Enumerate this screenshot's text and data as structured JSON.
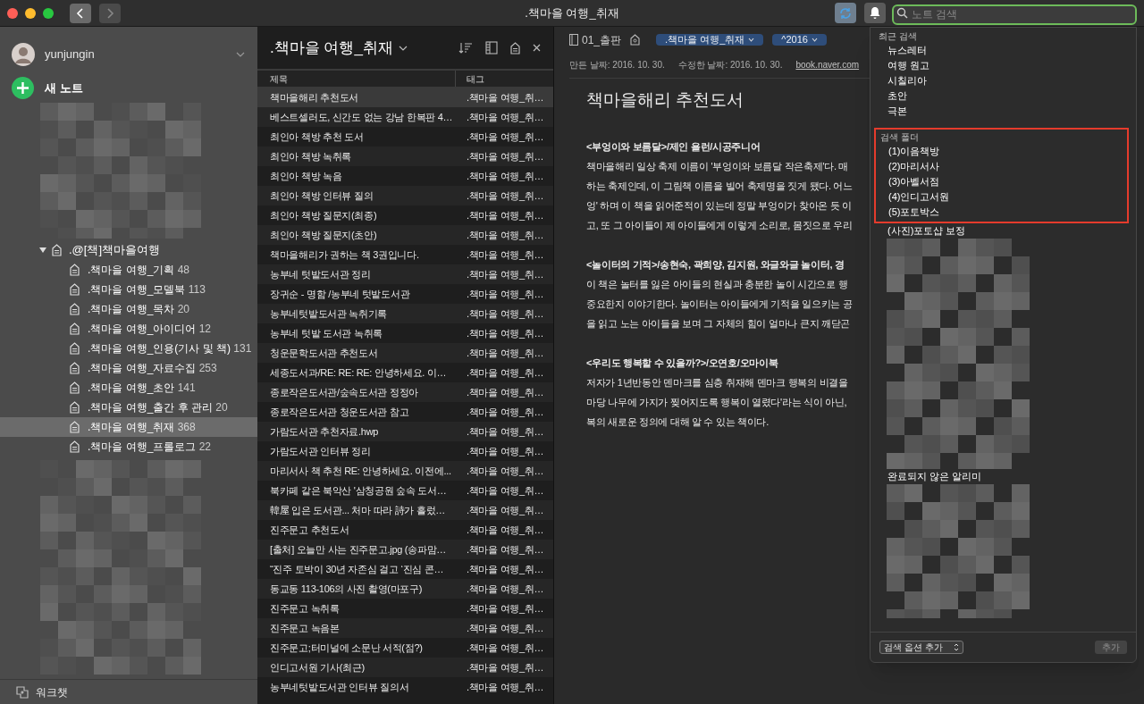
{
  "window": {
    "title": ".책마을 여행_취재"
  },
  "toolbar": {
    "back_enabled": true,
    "forward_enabled": false,
    "search": {
      "placeholder": "노트 검색"
    }
  },
  "sidebar": {
    "account": "yunjungin",
    "new_note": "새 노트",
    "notebooks": [
      {
        "name": ".@[책]책마을여행",
        "expanded": true,
        "children": [
          {
            "name": ".책마을 여행_기획",
            "count": "48",
            "selected": false
          },
          {
            "name": ".책마을 여행_모델북",
            "count": "113",
            "selected": false
          },
          {
            "name": ".책마을 여행_목차",
            "count": "20",
            "selected": false
          },
          {
            "name": ".책마을 여행_아이디어",
            "count": "12",
            "selected": false
          },
          {
            "name": ".책마을 여행_인용(기사 및 책)",
            "count": "131",
            "selected": false
          },
          {
            "name": ".책마을 여행_자료수집",
            "count": "253",
            "selected": false
          },
          {
            "name": ".책마을 여행_초안",
            "count": "141",
            "selected": false
          },
          {
            "name": ".책마을 여행_출간 후 관리",
            "count": "20",
            "selected": false
          },
          {
            "name": ".책마을 여행_취재",
            "count": "368",
            "selected": true
          },
          {
            "name": ".책마을 여행_프롤로그",
            "count": "22",
            "selected": false
          }
        ]
      }
    ],
    "footer": "워크챗"
  },
  "note_list": {
    "title": ".책마을 여행_취재",
    "columns": [
      "제목",
      "태그"
    ],
    "rows": [
      {
        "title": "책마을해리 추천도서",
        "tag": ".책마을 여행_취…",
        "selected": true
      },
      {
        "title": "베스트셀러도, 신간도 없는 강남 한복판 4…",
        "tag": ".책마을 여행_취…",
        "selected": false
      },
      {
        "title": "최인아 책방 추천 도서",
        "tag": ".책마을 여행_취…",
        "selected": false
      },
      {
        "title": "최인아 책방 녹취록",
        "tag": ".책마을 여행_취…",
        "selected": false
      },
      {
        "title": "최인아 책방 녹음",
        "tag": ".책마을 여행_취…",
        "selected": false
      },
      {
        "title": "최인아 책방 인터뷰 질의",
        "tag": ".책마을 여행_취…",
        "selected": false
      },
      {
        "title": "최인아 책방 질문지(최종)",
        "tag": ".책마을 여행_취…",
        "selected": false
      },
      {
        "title": "최인아 책방 질문지(초안)",
        "tag": ".책마을 여행_취…",
        "selected": false
      },
      {
        "title": "책마을해리가 권하는 책 3권입니다.",
        "tag": ".책마을 여행_취…",
        "selected": false
      },
      {
        "title": "농부네 텃밭도서관 정리",
        "tag": ".책마을 여행_취…",
        "selected": false
      },
      {
        "title": "장귀순 - 명함 /농부네 텃밭도서관",
        "tag": ".책마을 여행_취…",
        "selected": false
      },
      {
        "title": "농부네텃밭도서관 녹취기록",
        "tag": ".책마을 여행_취…",
        "selected": false
      },
      {
        "title": "농부네 텃밭 도서관 녹취록",
        "tag": ".책마을 여행_취…",
        "selected": false
      },
      {
        "title": "청운문학도서관 추천도서",
        "tag": ".책마을 여행_취…",
        "selected": false
      },
      {
        "title": "세종도서과/RE: RE: RE: 안녕하세요. 이…",
        "tag": ".책마을 여행_취…",
        "selected": false
      },
      {
        "title": "종로작은도서관/숲속도서관 정정아",
        "tag": ".책마을 여행_취…",
        "selected": false
      },
      {
        "title": "종로작은도서관 청운도서관 참고",
        "tag": ".책마을 여행_취…",
        "selected": false
      },
      {
        "title": "가람도서관 추천자료.hwp",
        "tag": ".책마을 여행_취…",
        "selected": false
      },
      {
        "title": "가람도서관 인터뷰 정리",
        "tag": ".책마을 여행_취…",
        "selected": false
      },
      {
        "title": "마리서사 책 추천 RE: 안녕하세요. 이전에...",
        "tag": ".책마을 여행_취…",
        "selected": false
      },
      {
        "title": "북카페 같은 북악산 '삼청공원 숲속 도서…",
        "tag": ".책마을 여행_취…",
        "selected": false
      },
      {
        "title": "韓屋 입은 도서관... 처마 따라 詩가 흘렀…",
        "tag": ".책마을 여행_취…",
        "selected": false
      },
      {
        "title": "진주문고 추천도서",
        "tag": ".책마을 여행_취…",
        "selected": false
      },
      {
        "title": "[출처] 오늘만 사는 진주문고.jpg (송파맘…",
        "tag": ".책마을 여행_취…",
        "selected": false
      },
      {
        "title": "“진주 토박이 30년 자존심 걸고 ‘진심 콘…",
        "tag": ".책마을 여행_취…",
        "selected": false
      },
      {
        "title": "동교동 113-106의 사진 촬영(마포구)",
        "tag": ".책마을 여행_취…",
        "selected": false
      },
      {
        "title": "진주문고 녹취록",
        "tag": ".책마을 여행_취…",
        "selected": false
      },
      {
        "title": "진주문고 녹음본",
        "tag": ".책마을 여행_취…",
        "selected": false
      },
      {
        "title": "진주문고;터미널에 소문난 서적(점?)",
        "tag": ".책마을 여행_취…",
        "selected": false
      },
      {
        "title": "인디고서원 기사(최근)",
        "tag": ".책마을 여행_취…",
        "selected": false
      },
      {
        "title": "농부네텃밭도서관 인터뷰 질의서",
        "tag": ".책마을 여행_취…",
        "selected": false
      }
    ]
  },
  "editor": {
    "notebook": "01_출판",
    "tags": [
      ".책마을 여행_취재",
      "^2016"
    ],
    "created": "만든 날짜: 2016. 10. 30.",
    "modified": "수정한 날짜: 2016. 10. 30.",
    "source_url": "book.naver.com",
    "title": "책마을해리 추천도서",
    "paragraphs": [
      {
        "heading": "<부엉이와 보름달>/제인 욜런/시공주니어",
        "lines": [
          "책마을해리 일상 축제 이름이 '부엉이와 보름달 작은축제'다. 매",
          "하는 축제인데, 이 그림책 이름을 빌어 축제명을 짓게 됐다. 어느",
          "엉' 하며 이 책을 읽어준적이 있는데 정말 부엉이가 찾아온 듯 이",
          "고, 또 그 아이들이 제 아이들에게 이렇게 소리로, 몸짓으로 우리"
        ]
      },
      {
        "heading": "<놀이터의 기적>/송현숙, 곽희양, 김지원, 와글와글 놀이터, 경",
        "lines": [
          "이 책은 놀터를 잃은 아이들의 현실과 충분한 놀이 시간으로 행",
          "중요한지 이야기한다. 놀이터는 아이들에게 기적을 일으키는 공",
          "을 읽고 노는 아이들을 보며 그 자체의 힘이 얼마나 큰지 깨닫곤"
        ]
      },
      {
        "heading": "<우리도 행복할 수 있을까?>/오연호/오마이북",
        "lines": [
          "저자가 1년반동안 덴마크를 심층 취재해 덴마크 행복의 비결을",
          "마당 나무에 가지가 찢어지도록 행복이 열렸다'라는 식이 아닌,",
          "복의 새로운 정의에 대해 알 수 있는 책이다."
        ]
      }
    ]
  },
  "search_dropdown": {
    "recent_label": "최근 검색",
    "recent": [
      "뉴스레터",
      "여행 원고",
      "시칠리아",
      "초안",
      "극본"
    ],
    "saved_label": "검색 폴더",
    "saved": [
      {
        "text": "(1)이음책방",
        "highlighted": true
      },
      {
        "text": "(2)마리서사",
        "highlighted": true
      },
      {
        "text": "(3)아벨서점",
        "highlighted": true
      },
      {
        "text": "(4)인디고서원",
        "highlighted": true
      },
      {
        "text": "(5)포토박스",
        "highlighted": true
      },
      {
        "text": "(사진)포토샵 보정",
        "highlighted": false
      },
      {
        "text": "완료되지 않은 알리미",
        "highlighted": false
      }
    ],
    "option_select": "검색 옵션 추가",
    "add_button": {
      "label": "추가",
      "disabled": true
    }
  }
}
